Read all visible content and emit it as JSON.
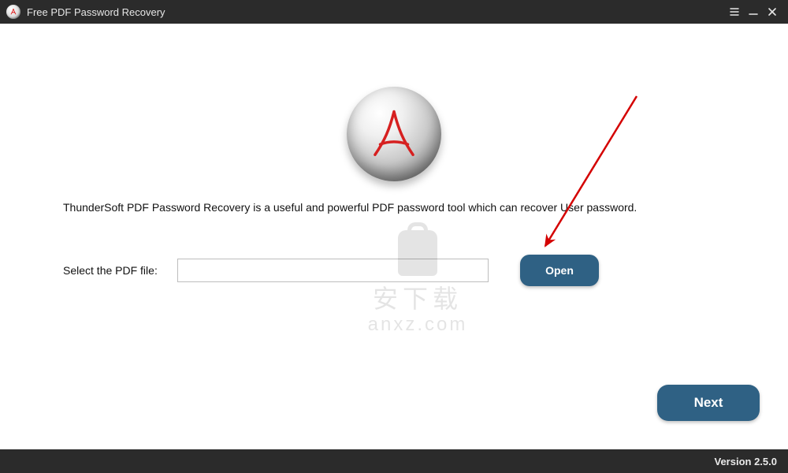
{
  "titlebar": {
    "title": "Free PDF Password Recovery"
  },
  "main": {
    "description": "ThunderSoft PDF Password Recovery is a useful and powerful PDF password tool which can recover User password.",
    "select_label": "Select the PDF file:",
    "file_value": "",
    "open_label": "Open",
    "next_label": "Next"
  },
  "watermark": {
    "line1": "安下载",
    "line2": "anxz.com"
  },
  "footer": {
    "version": "Version 2.5.0"
  }
}
